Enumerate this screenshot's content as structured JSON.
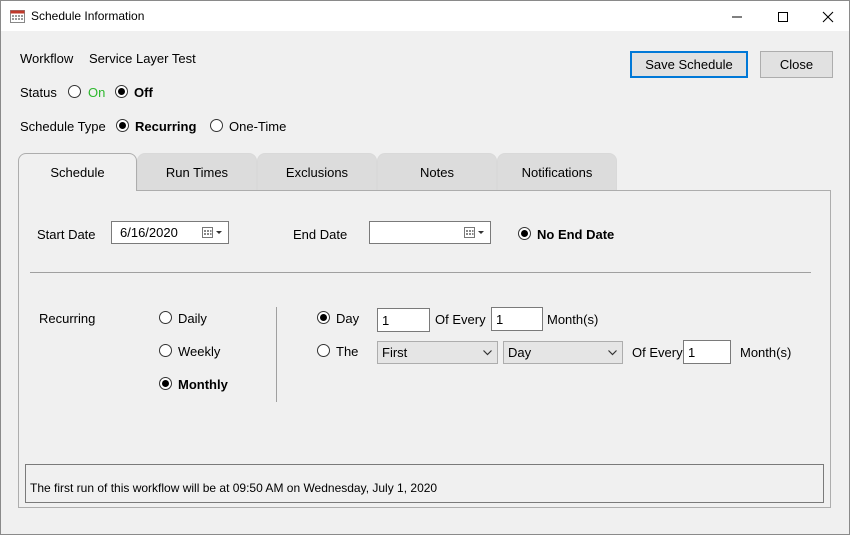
{
  "window": {
    "title": "Schedule Information"
  },
  "header": {
    "workflow_label": "Workflow",
    "workflow_value": "Service Layer Test",
    "status_label": "Status",
    "status_on": "On",
    "status_off": "Off",
    "status_selected": "Off",
    "schedule_type_label": "Schedule Type",
    "type_recurring": "Recurring",
    "type_one_time": "One-Time",
    "type_selected": "Recurring",
    "save_button": "Save Schedule",
    "close_button": "Close"
  },
  "tabs": [
    {
      "label": "Schedule",
      "active": true
    },
    {
      "label": "Run Times",
      "active": false
    },
    {
      "label": "Exclusions",
      "active": false
    },
    {
      "label": "Notes",
      "active": false
    },
    {
      "label": "Notifications",
      "active": false
    }
  ],
  "schedule": {
    "start_date_label": "Start Date",
    "start_date_value": "6/16/2020",
    "end_date_label": "End Date",
    "end_date_value": "",
    "no_end_date_label": "No End Date",
    "recurring_label": "Recurring",
    "frequency": {
      "daily": "Daily",
      "weekly": "Weekly",
      "monthly": "Monthly",
      "selected": "Monthly"
    },
    "monthly": {
      "day_label": "Day",
      "day_value": "1",
      "of_every_label": "Of Every",
      "of_every_value": "1",
      "months_label": "Month(s)",
      "the_label": "The",
      "ordinal_select": "First",
      "weekday_select": "Day",
      "of_every_label_2": "Of Every",
      "of_every_value_2": "1",
      "months_label_2": "Month(s)",
      "selected": "Day"
    },
    "info_text": "The first run of this workflow will be at 09:50 AM on Wednesday, July 1, 2020"
  },
  "colors": {
    "on_label": "#2eb82e",
    "accent": "#0078d7"
  }
}
